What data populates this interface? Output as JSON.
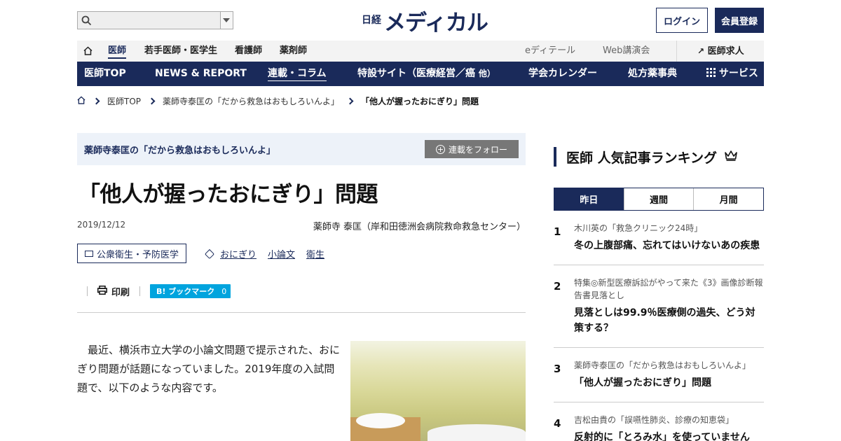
{
  "header": {
    "logo_sub": "日経",
    "logo_main": "メディカル",
    "login": "ログイン",
    "register": "会員登録"
  },
  "subnav": {
    "items": [
      "医師",
      "若手医師・医学生",
      "看護師",
      "薬剤師"
    ],
    "right": [
      "eディテール",
      "Web講演会"
    ],
    "job": "医師求人"
  },
  "mainnav": {
    "items": [
      "医師TOP",
      "NEWS & REPORT",
      "連載・コラム",
      "特設サイト（医療経営／癌"
    ],
    "items_small": "他）",
    "items2": [
      "学会カレンダー",
      "処方薬事典",
      "サービス"
    ]
  },
  "breadcrumb": [
    "医師TOP",
    "薬師寺泰匡の「だから救急はおもしろいんよ」",
    "「他人が握ったおにぎり」問題"
  ],
  "article": {
    "series": "薬師寺泰匡の「だから救急はおもしろいんよ」",
    "follow": "連載をフォロー",
    "title": "「他人が握ったおにぎり」問題",
    "date": "2019/12/12",
    "author": "薬師寺 泰匡（岸和田徳洲会病院救命救急センター）",
    "category": "公衆衛生・予防医学",
    "tags": [
      "おにぎり",
      "小論文",
      "衛生"
    ],
    "print": "印刷",
    "bookmark": "ブックマーク",
    "bookmark_logo": "B!",
    "bookmark_count": "0",
    "body": "　最近、横浜市立大学の小論文問題で提示された、おにぎり問題が話題になっていました。2019年度の入試問題で、以下のような内容です。"
  },
  "ranking": {
    "title": "医師 人気記事ランキング",
    "tabs": [
      "昨日",
      "週間",
      "月間"
    ],
    "items": [
      {
        "num": "1",
        "series": "木川英の「救急クリニック24時」",
        "title": "冬の上腹部痛、忘れてはいけないあの疾患"
      },
      {
        "num": "2",
        "series": "特集◎新型医療訴訟がやって来た《3》画像診断報告書見落とし",
        "title": "見落としは99.9％医療側の過失、どう対策する？"
      },
      {
        "num": "3",
        "series": "薬師寺泰匡の「だから救急はおもしろいんよ」",
        "title": "「他人が握ったおにぎり」問題"
      },
      {
        "num": "4",
        "series": "吉松由貴の「誤嚥性肺炎、診療の知恵袋」",
        "title": "反射的に「とろみ水」を使っていません"
      }
    ]
  }
}
